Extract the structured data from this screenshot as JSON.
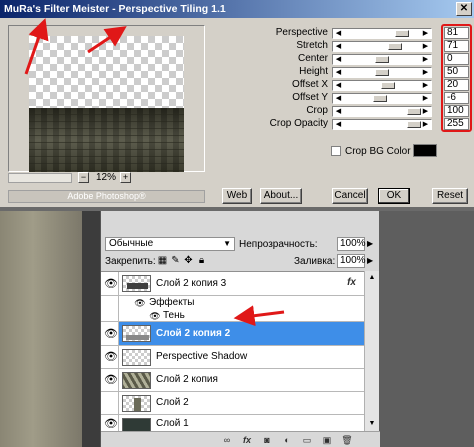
{
  "dialog": {
    "title": "MuRa's Filter Meister - Perspective Tiling 1.1",
    "close_glyph": "✕",
    "zoom": {
      "minus": "−",
      "plus": "+",
      "value": "12%"
    },
    "adobe_label": "Adobe Photoshop®",
    "params": [
      {
        "label": "Perspective",
        "value": "81",
        "level": 0.81
      },
      {
        "label": "Stretch",
        "value": "71",
        "level": 0.71
      },
      {
        "label": "Center",
        "value": "0",
        "level": 0.5
      },
      {
        "label": "Height",
        "value": "50",
        "level": 0.5
      },
      {
        "label": "Offset X",
        "value": "20",
        "level": 0.6
      },
      {
        "label": "Offset Y",
        "value": "-6",
        "level": 0.47
      },
      {
        "label": "Crop",
        "value": "100",
        "level": 1.0
      },
      {
        "label": "Crop Opacity",
        "value": "255",
        "level": 1.0
      }
    ],
    "crop_bg_label": "Crop BG Color",
    "crop_bg_color": "#000000",
    "buttons": {
      "web": "Web",
      "about": "About...",
      "cancel": "Cancel",
      "ok": "OK",
      "reset": "Reset"
    }
  },
  "layers_panel": {
    "blend_mode": "Обычные",
    "opacity_label": "Непрозрачность:",
    "opacity_value": "100%",
    "lock_label": "Закрепить:",
    "fill_label": "Заливка:",
    "fill_value": "100%",
    "layers": [
      {
        "name": "Слой 2 копия 3",
        "visible": true,
        "fx": "fx",
        "selected": false
      },
      {
        "name": "Эффекты",
        "sub": true
      },
      {
        "name": "Тень",
        "sub": true
      },
      {
        "name": "Слой 2 копия 2",
        "visible": true,
        "selected": true
      },
      {
        "name": "Perspective Shadow",
        "visible": true,
        "selected": false
      },
      {
        "name": "Слой 2 копия",
        "visible": true,
        "selected": false
      },
      {
        "name": "Слой 2",
        "visible": false,
        "selected": false
      },
      {
        "name": "Слой 1",
        "visible": true,
        "selected": false
      }
    ]
  },
  "colors": {
    "annotation_red": "#e01818",
    "selection_blue": "#3e8ee8"
  }
}
